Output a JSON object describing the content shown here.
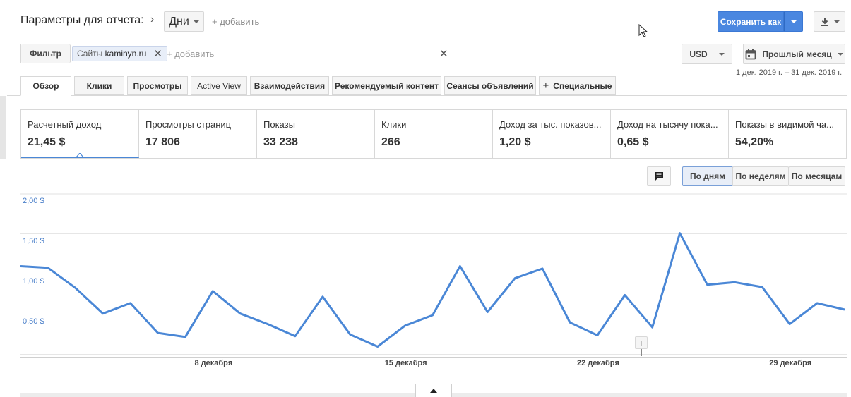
{
  "header": {
    "title": "Параметры для отчета:",
    "period_select": "Дни",
    "add_link": "+ добавить",
    "save_label": "Сохранить как"
  },
  "filter": {
    "label": "Фильтр",
    "chip_prefix": "Сайты",
    "chip_value": "kaminyn.ru",
    "add_link": "+ добавить"
  },
  "currency": {
    "value": "USD"
  },
  "date_range": {
    "label": "Прошлый месяц",
    "range_text": "1 дек. 2019 г. – 31 дек. 2019 г."
  },
  "tabs": [
    {
      "label": "Обзор"
    },
    {
      "label": "Клики"
    },
    {
      "label": "Просмотры"
    },
    {
      "label": "Active View"
    },
    {
      "label": "Взаимодействия"
    },
    {
      "label": "Рекомендуемый контент"
    },
    {
      "label": "Сеансы объявлений"
    },
    {
      "label": "Специальные"
    }
  ],
  "metrics": [
    {
      "label": "Расчетный доход",
      "value": "21,45 $"
    },
    {
      "label": "Просмотры страниц",
      "value": "17 806"
    },
    {
      "label": "Показы",
      "value": "33 238"
    },
    {
      "label": "Клики",
      "value": "266"
    },
    {
      "label": "Доход за тыс. показов...",
      "value": "1,20 $"
    },
    {
      "label": "Доход на тысячу пока...",
      "value": "0,65 $"
    },
    {
      "label": "Показы в видимой ча...",
      "value": "54,20%"
    }
  ],
  "granularity": {
    "day": "По дням",
    "week": "По неделям",
    "month": "По месяцам"
  },
  "chart_data": {
    "type": "line",
    "y_ticks": [
      "2,00 $",
      "1,50 $",
      "1,00 $",
      "0,50 $"
    ],
    "x_ticks": [
      {
        "day": 8,
        "label": "8 декабря"
      },
      {
        "day": 15,
        "label": "15 декабря"
      },
      {
        "day": 22,
        "label": "22 декабря"
      },
      {
        "day": 29,
        "label": "29 декабря"
      }
    ],
    "ylim": [
      0,
      2.0
    ],
    "grid": true,
    "color": "#4a87d6",
    "x": [
      1,
      2,
      3,
      4,
      5,
      6,
      7,
      8,
      9,
      10,
      11,
      12,
      13,
      14,
      15,
      16,
      17,
      18,
      19,
      20,
      21,
      22,
      23,
      24,
      25,
      26,
      27,
      28,
      29,
      30,
      31
    ],
    "values": [
      1.18,
      1.16,
      0.91,
      0.59,
      0.72,
      0.35,
      0.3,
      0.87,
      0.59,
      0.46,
      0.31,
      0.8,
      0.33,
      0.18,
      0.44,
      0.57,
      1.18,
      0.61,
      1.03,
      1.15,
      0.48,
      0.32,
      0.82,
      0.42,
      1.59,
      0.95,
      0.98,
      0.92,
      0.46,
      0.72,
      0.64
    ]
  }
}
